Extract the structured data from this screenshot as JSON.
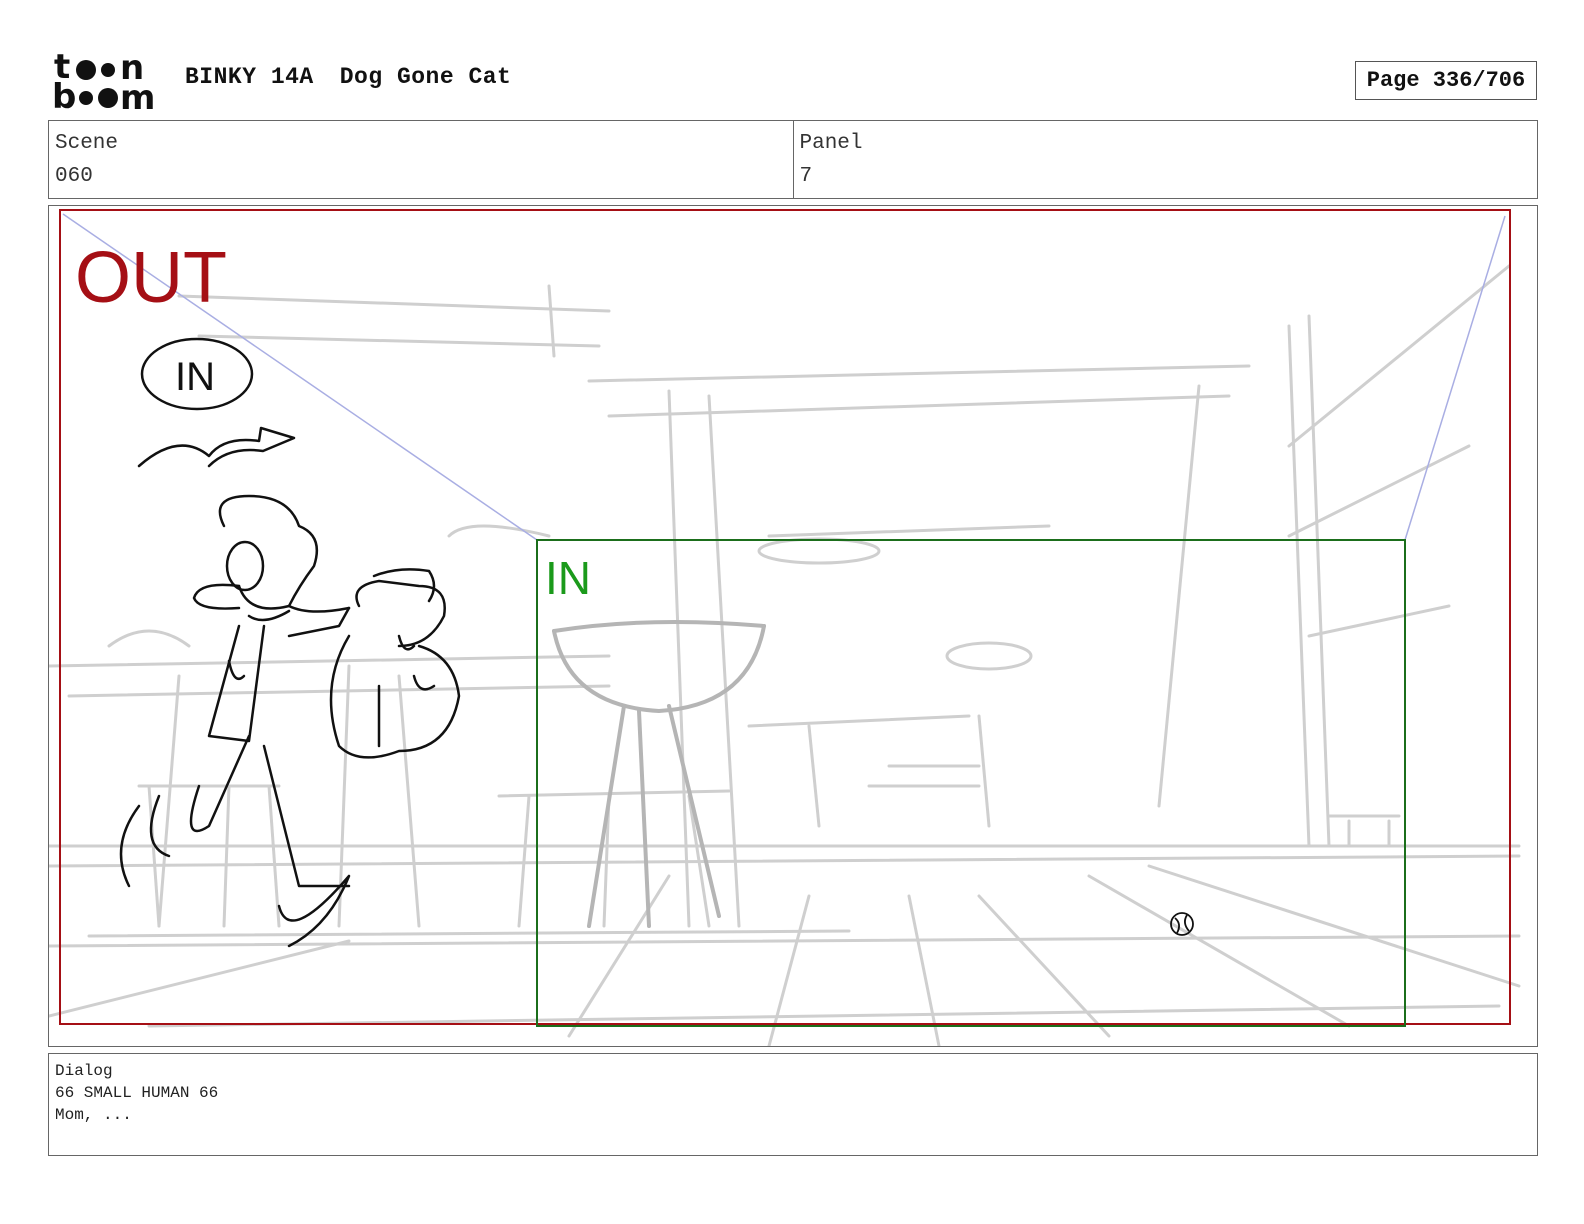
{
  "header": {
    "logo_text": "toon boom",
    "show": "BINKY 14A",
    "episode": "Dog Gone Cat",
    "page": "Page 336/706"
  },
  "info": {
    "scene_label": "Scene",
    "scene_value": "060",
    "panel_label": "Panel",
    "panel_value": "7"
  },
  "frame": {
    "out_label": "OUT",
    "in_label": "IN",
    "sketch_note": "IN",
    "out_color": "#a50f15",
    "in_color": "#1b8a1b",
    "guide_color": "#9aa0e0"
  },
  "dialog": {
    "label": "Dialog",
    "character": "66 SMALL HUMAN 66",
    "line": "Mom, ..."
  }
}
